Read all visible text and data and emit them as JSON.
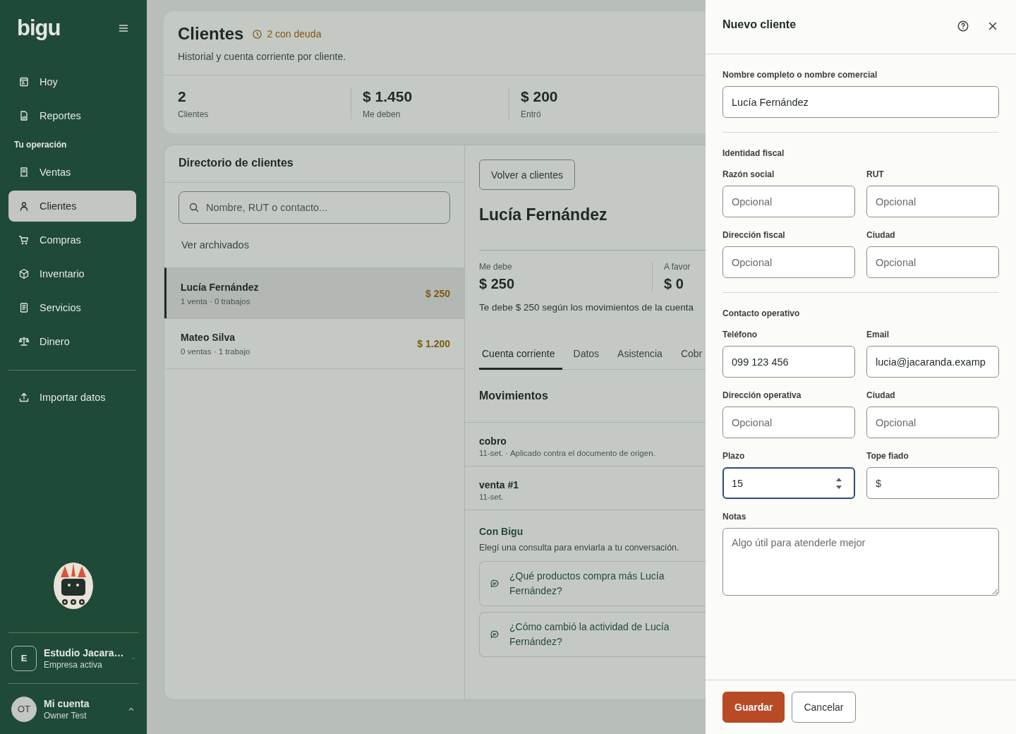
{
  "sidebar": {
    "logo": "bigu",
    "nav_top": [
      {
        "label": "Hoy",
        "selected": false
      },
      {
        "label": "Reportes",
        "selected": false
      }
    ],
    "section": {
      "label": "Tu operación",
      "items": [
        {
          "label": "Ventas",
          "selected": false
        },
        {
          "label": "Clientes",
          "selected": true
        },
        {
          "label": "Compras",
          "selected": false
        },
        {
          "label": "Inventario",
          "selected": false
        },
        {
          "label": "Servicios",
          "selected": false
        },
        {
          "label": "Dinero",
          "selected": false
        }
      ]
    },
    "import_item": {
      "label": "Importar datos",
      "selected": false
    },
    "workspace": {
      "initial": "E",
      "name": "Estudio Jacara…",
      "subtitle": "Empresa activa"
    },
    "account": {
      "initials": "OT",
      "name": "Mi cuenta",
      "subtitle": "Owner Test"
    }
  },
  "header": {
    "title": "Clientes",
    "badge": "2 con deuda",
    "subtitle": "Historial y cuenta corriente por cliente.",
    "stats": [
      {
        "value": "2",
        "label": "Clientes"
      },
      {
        "value": "$ 1.450",
        "label": "Me deben"
      },
      {
        "value": "$ 200",
        "label": "Entró"
      }
    ]
  },
  "directory": {
    "title": "Directorio de clientes",
    "search": {
      "placeholder": "Nombre, RUT o contacto..."
    },
    "archived_link": "Ver archivados",
    "clients": [
      {
        "name": "Lucía Fernández",
        "meta": "1 venta · 0 trabajos",
        "amount": "$ 250",
        "selected": true
      },
      {
        "name": "Mateo Silva",
        "meta": "0 ventas · 1 trabajo",
        "amount": "$ 1.200",
        "selected": false
      }
    ]
  },
  "detail": {
    "back_button": "Volver a clientes",
    "name": "Lucía Fernández",
    "balances": [
      {
        "label": "Me debe",
        "value": "$ 250"
      },
      {
        "label": "A favor",
        "value": "$ 0"
      }
    ],
    "summary": "Te debe $ 250 según los movimientos de la cuenta",
    "tabs": [
      {
        "label": "Cuenta corriente",
        "selected": true
      },
      {
        "label": "Datos",
        "selected": false
      },
      {
        "label": "Asistencia",
        "selected": false
      },
      {
        "label": "Cobr",
        "selected": false
      }
    ],
    "movements_title": "Movimientos",
    "movements": [
      {
        "title": "cobro",
        "meta": "11-set. · Aplicado contra el documento de origen."
      },
      {
        "title": "venta #1",
        "meta": "11-set."
      }
    ],
    "assistant": {
      "title": "Con Bigu",
      "subtitle": "Elegí una consulta para enviarla a tu conversación.",
      "suggestions": [
        "¿Qué productos compra más Lucía Fernández?",
        "¿Cómo cambió la actividad de Lucía Fernández?"
      ]
    }
  },
  "drawer": {
    "title": "Nuevo cliente",
    "name_field": {
      "label": "Nombre completo o nombre comercial",
      "value": "Lucía Fernández"
    },
    "sections": [
      {
        "title": "Identidad fiscal",
        "fields": [
          {
            "kind": "text",
            "label": "Razón social",
            "placeholder": "Opcional"
          },
          {
            "kind": "text",
            "label": "RUT",
            "placeholder": "Opcional"
          },
          {
            "kind": "text",
            "label": "Dirección fiscal",
            "placeholder": "Opcional"
          },
          {
            "kind": "text",
            "label": "Ciudad",
            "placeholder": "Opcional"
          }
        ]
      },
      {
        "title": "Contacto operativo",
        "fields": [
          {
            "kind": "text",
            "label": "Teléfono",
            "value": "099 123 456"
          },
          {
            "kind": "text",
            "label": "Email",
            "value": "lucia@jacaranda.examp"
          },
          {
            "kind": "text",
            "label": "Dirección operativa",
            "placeholder": "Opcional"
          },
          {
            "kind": "text",
            "label": "Ciudad",
            "placeholder": "Opcional"
          },
          {
            "kind": "number",
            "label": "Plazo",
            "value": "15",
            "focused": true
          },
          {
            "kind": "currency",
            "label": "Tope fiado",
            "prefix": "$"
          }
        ]
      }
    ],
    "notes": {
      "label": "Notas",
      "placeholder": "Algo útil para atenderle mejor"
    },
    "buttons": [
      {
        "label": "Guardar",
        "kind": "primary"
      },
      {
        "label": "Cancelar",
        "kind": "secondary"
      }
    ]
  }
}
